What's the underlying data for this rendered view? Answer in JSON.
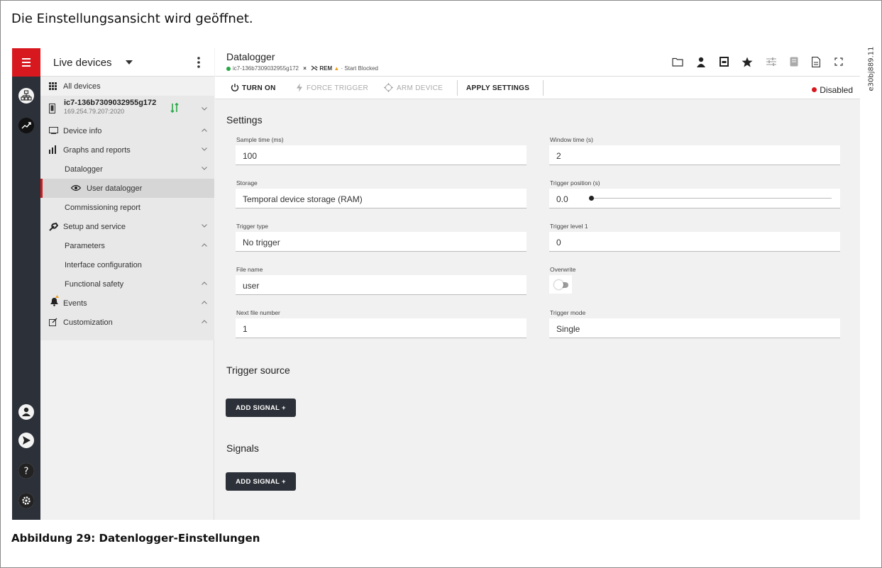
{
  "document": {
    "intro": "Die Einstellungsansicht wird geöffnet.",
    "figure_caption": "Abbildung 29: Datenlogger-Einstellungen",
    "figure_code": "e30bj889.11"
  },
  "colors": {
    "accent": "#d7191f",
    "rail": "#2c3038",
    "ok": "#27a844",
    "warn": "#f0a020"
  },
  "rail": {
    "top_items": [
      "menu-icon",
      "network-icon",
      "trend-icon"
    ],
    "bottom_items": [
      "user-icon",
      "send-icon",
      "help-icon",
      "gear-icon"
    ],
    "help_glyph": "?"
  },
  "tree": {
    "title": "Live devices",
    "all_devices": "All devices",
    "device": {
      "name": "ic7-136b7309032955g172",
      "ip": "169.254.79.207:2020"
    },
    "items": {
      "device_info": "Device info",
      "graphs_reports": "Graphs and reports",
      "datalogger": "Datalogger",
      "user_datalogger": "User datalogger",
      "commissioning": "Commissioning report",
      "setup_service": "Setup and service",
      "parameters": "Parameters",
      "interface_config": "Interface configuration",
      "functional_safety": "Functional safety",
      "events": "Events",
      "customization": "Customization"
    }
  },
  "header": {
    "title": "Datalogger",
    "device": "ic7-136b7309032955g172",
    "x": "×",
    "rem": "REM",
    "warn": "▲",
    "blocked": "· Start Blocked",
    "icons": [
      "folder-icon",
      "person-icon",
      "save-icon",
      "star-icon",
      "sliders-icon",
      "book-icon",
      "document-icon",
      "fullscreen-icon"
    ]
  },
  "toolbar": {
    "turn_on": "TURN ON",
    "force_trigger": "FORCE TRIGGER",
    "arm_device": "ARM DEVICE",
    "apply": "APPLY SETTINGS",
    "state": "Disabled"
  },
  "settings": {
    "title": "Settings",
    "sample_time_label": "Sample time (ms)",
    "sample_time": "100",
    "window_time_label": "Window time (s)",
    "window_time": "2",
    "storage_label": "Storage",
    "storage": "Temporal device storage (RAM)",
    "trigger_pos_label": "Trigger position (s)",
    "trigger_pos": "0.0",
    "trigger_pos_slider_fraction": 0.0,
    "trigger_type_label": "Trigger type",
    "trigger_type": "No trigger",
    "trigger_level_label": "Trigger level 1",
    "trigger_level": "0",
    "file_name_label": "File name",
    "file_name": "user",
    "overwrite_label": "Overwrite",
    "overwrite": false,
    "next_file_label": "Next file number",
    "next_file": "1",
    "trigger_mode_label": "Trigger mode",
    "trigger_mode": "Single"
  },
  "trigger_source": {
    "title": "Trigger source",
    "add_signal": "ADD SIGNAL +"
  },
  "signals": {
    "title": "Signals",
    "add_signal": "ADD SIGNAL +"
  }
}
